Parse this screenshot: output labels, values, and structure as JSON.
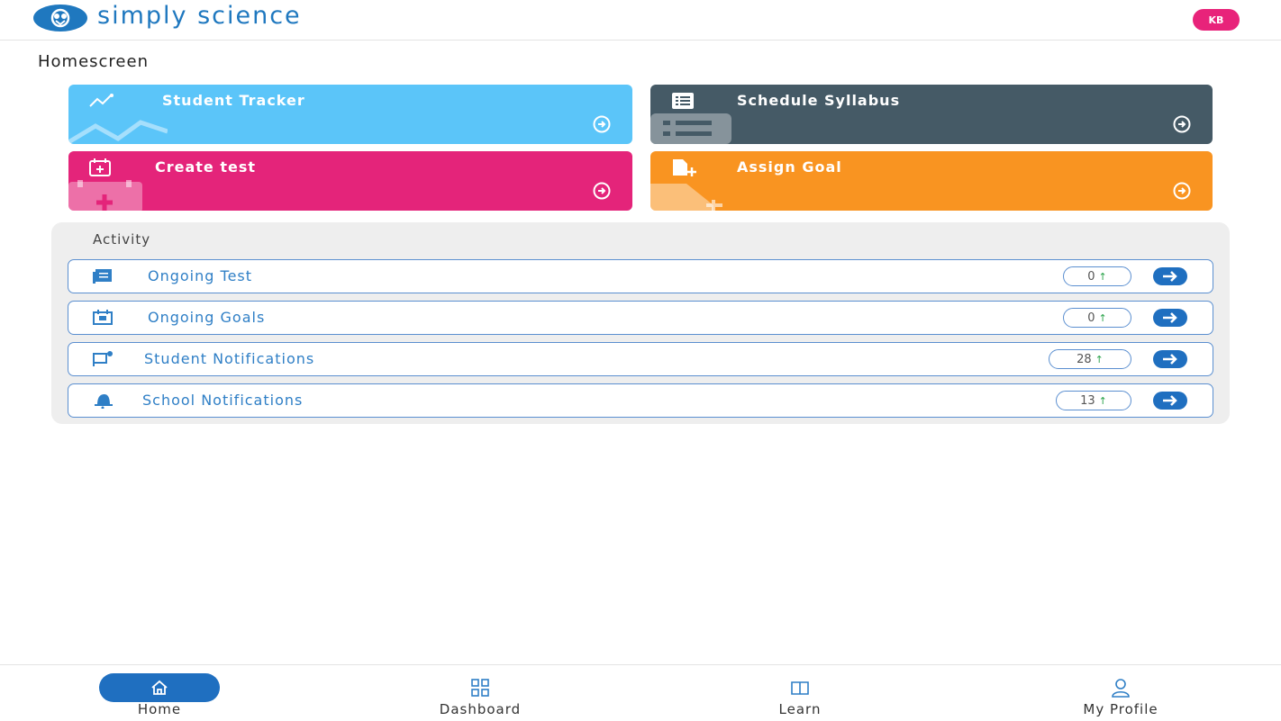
{
  "header": {
    "brand": "simply science",
    "avatar_initials": "KB"
  },
  "page_title": "Homescreen",
  "cards": [
    {
      "label": "Student Tracker",
      "color": "#5bc5f9",
      "icon": "chart-sparkle-icon"
    },
    {
      "label": "Schedule Syllabus",
      "color": "#455a66",
      "icon": "list-icon"
    },
    {
      "label": "Create test",
      "color": "#e4247a",
      "icon": "calendar-plus-icon"
    },
    {
      "label": "Assign Goal",
      "color": "#f99421",
      "icon": "file-plus-icon"
    }
  ],
  "activity": {
    "title": "Activity",
    "rows": [
      {
        "label": "Ongoing Test",
        "count": "0",
        "icon": "test-list-icon"
      },
      {
        "label": "Ongoing Goals",
        "count": "0",
        "icon": "goal-calendar-icon"
      },
      {
        "label": "Student Notifications",
        "count": "28",
        "icon": "flag-notification-icon"
      },
      {
        "label": "School Notifications",
        "count": "13",
        "icon": "bell-icon"
      }
    ]
  },
  "nav": {
    "items": [
      {
        "label": "Home",
        "icon": "home-icon",
        "active": true
      },
      {
        "label": "Dashboard",
        "icon": "grid-icon"
      },
      {
        "label": "Learn",
        "icon": "book-icon"
      },
      {
        "label": "My Profile",
        "icon": "user-icon"
      }
    ]
  },
  "colors": {
    "brand_blue": "#1f78bf",
    "nav_active": "#1f6fc0",
    "row_border": "#5b8fd0",
    "badge_up": "#2aa34a"
  }
}
